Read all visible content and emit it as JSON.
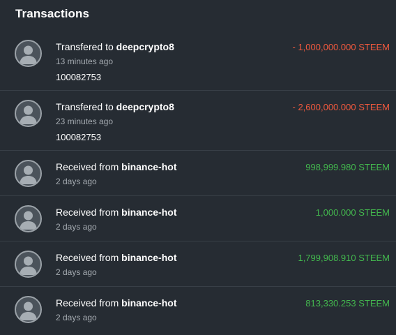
{
  "title": "Transactions",
  "colors": {
    "background": "#262c33",
    "outgoing": "#f0593e",
    "incoming": "#43b84e",
    "muted_text": "#a5abb1"
  },
  "transactions": [
    {
      "action": "Transfered to",
      "party": "deepcrypto8",
      "time": "13 minutes ago",
      "memo": "100082753",
      "amount": "- 1,000,000.000 STEEM",
      "direction": "out",
      "avatar_icon": "default-user-avatar-icon"
    },
    {
      "action": "Transfered to",
      "party": "deepcrypto8",
      "time": "23 minutes ago",
      "memo": "100082753",
      "amount": "- 2,600,000.000 STEEM",
      "direction": "out",
      "avatar_icon": "default-user-avatar-icon"
    },
    {
      "action": "Received from",
      "party": "binance-hot",
      "time": "2 days ago",
      "amount": "998,999.980 STEEM",
      "direction": "in",
      "avatar_icon": "default-user-avatar-icon"
    },
    {
      "action": "Received from",
      "party": "binance-hot",
      "time": "2 days ago",
      "amount": "1,000.000 STEEM",
      "direction": "in",
      "avatar_icon": "default-user-avatar-icon"
    },
    {
      "action": "Received from",
      "party": "binance-hot",
      "time": "2 days ago",
      "amount": "1,799,908.910 STEEM",
      "direction": "in",
      "avatar_icon": "default-user-avatar-icon"
    },
    {
      "action": "Received from",
      "party": "binance-hot",
      "time": "2 days ago",
      "amount": "813,330.253 STEEM",
      "direction": "in",
      "avatar_icon": "default-user-avatar-icon"
    }
  ]
}
